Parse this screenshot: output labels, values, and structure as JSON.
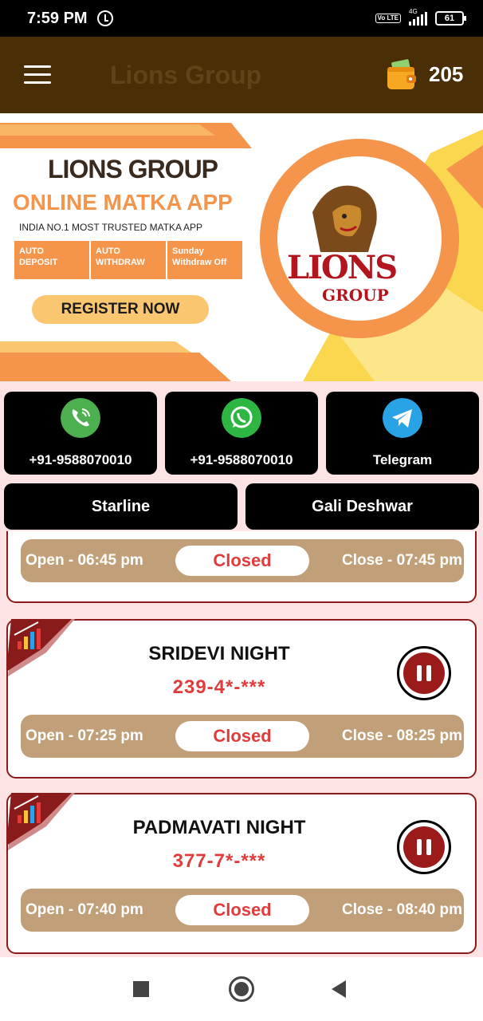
{
  "status_bar": {
    "time": "7:59 PM",
    "network": "4G",
    "volte": "Vo LTE",
    "battery": "61"
  },
  "app_bar": {
    "title": "Lions Group",
    "wallet_balance": "205"
  },
  "banner": {
    "title": "LIONS GROUP",
    "subtitle": "ONLINE MATKA APP",
    "tagline": "INDIA NO.1 MOST TRUSTED MATKA APP",
    "features": [
      "AUTO DEPOSIT",
      "AUTO WITHDRAW",
      "Sunday Withdraw Off"
    ],
    "register_label": "REGISTER NOW",
    "logo_text": "LIONS",
    "logo_sub": "GROUP",
    "colors": {
      "accent": "#f5944b",
      "logo_red": "#b3151c"
    }
  },
  "contacts": [
    {
      "label": "+91-9588070010",
      "icon": "phone-icon",
      "color": "#4caf50"
    },
    {
      "label": "+91-9588070010",
      "icon": "whatsapp-icon",
      "color": "#2db742"
    },
    {
      "label": "Telegram",
      "icon": "telegram-icon",
      "color": "#2aa3e6"
    }
  ],
  "nav_buttons": [
    "Starline",
    "Gali Deshwar"
  ],
  "games": [
    {
      "name": "",
      "result": "",
      "open": "Open - 06:45 pm",
      "close": "Close - 07:45 pm",
      "status": "Closed"
    },
    {
      "name": "SRIDEVI NIGHT",
      "result": "239-4*-***",
      "open": "Open - 07:25 pm",
      "close": "Close - 08:25 pm",
      "status": "Closed"
    },
    {
      "name": "PADMAVATI NIGHT",
      "result": "377-7*-***",
      "open": "Open - 07:40 pm",
      "close": "Close - 08:40 pm",
      "status": "Closed"
    }
  ]
}
